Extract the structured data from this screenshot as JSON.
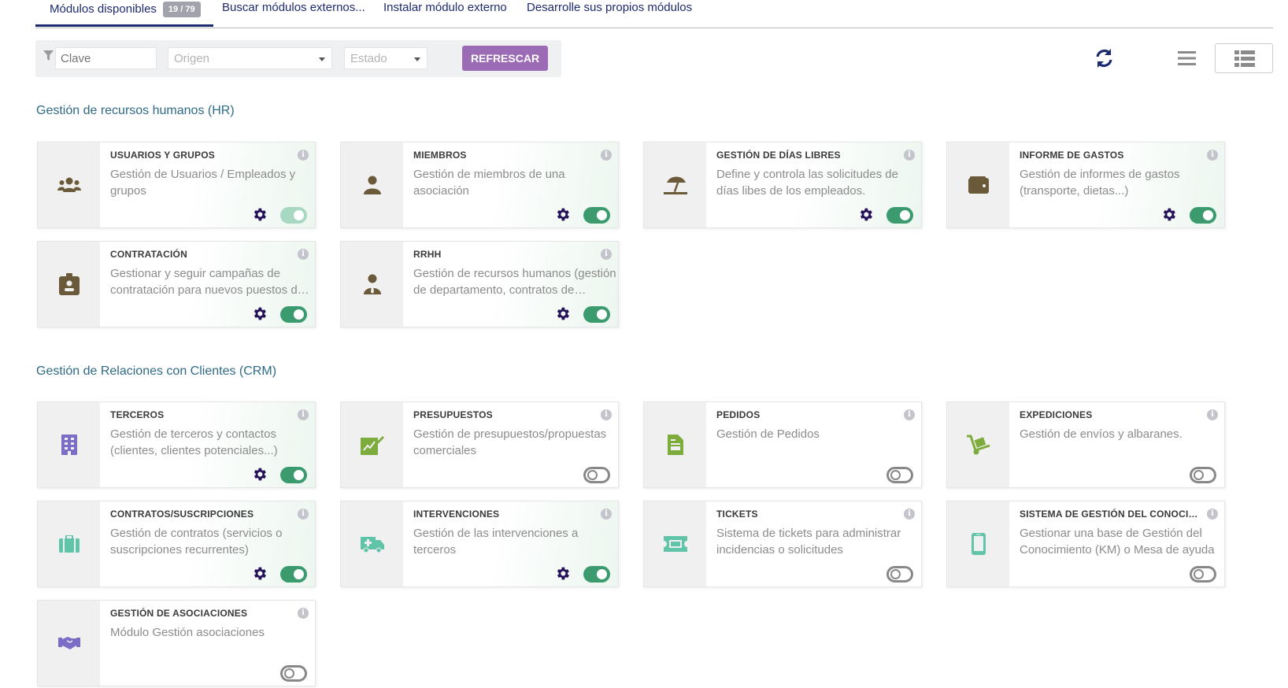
{
  "tabs": {
    "available_label": "Módulos disponibles",
    "available_count": "19 / 79",
    "search_label": "Buscar módulos externos...",
    "install_label": "Instalar módulo externo",
    "develop_label": "Desarrolle sus propios módulos"
  },
  "filter": {
    "keyword_placeholder": "Clave",
    "origin_placeholder": "Origen",
    "status_placeholder": "Estado",
    "refresh_label": "REFRESCAR"
  },
  "colors": {
    "accent": "#9b6bb5",
    "nav": "#1e2a6e",
    "toggle_on": "#3b9b6e",
    "hr_icon": "#6b5a3a",
    "crm_purple": "#7b6cc6",
    "crm_green": "#7dab3c",
    "crm_teal": "#5fc4a8"
  },
  "sections": [
    {
      "title": "Gestión de recursos humanos (HR)",
      "modules": [
        {
          "name": "USUARIOS Y GRUPOS",
          "description": "Gestión de Usuarios / Empleados y grupos",
          "icon": "users-icon",
          "enabled": true,
          "configurable": true
        },
        {
          "name": "MIEMBROS",
          "description": "Gestión de miembros de una asociación",
          "icon": "member-icon",
          "enabled": true,
          "configurable": true
        },
        {
          "name": "GESTIÓN DE DÍAS LIBRES",
          "description": "Define y controla las solicitudes de días libes de los empleados.",
          "icon": "beach-umbrella-icon",
          "enabled": true,
          "configurable": true
        },
        {
          "name": "INFORME DE GASTOS",
          "description": "Gestión de informes de gastos (transporte, dietas...)",
          "icon": "wallet-icon",
          "enabled": true,
          "configurable": true
        },
        {
          "name": "CONTRATACIÓN",
          "description": "Gestionar y seguir campañas de contratación para nuevos puestos de trabajo",
          "icon": "id-badge-icon",
          "enabled": true,
          "configurable": true
        },
        {
          "name": "RRHH",
          "description": "Gestión de recursos humanos (gestión de departamento, contratos de empleados...)",
          "icon": "user-tie-icon",
          "enabled": true,
          "configurable": true
        }
      ]
    },
    {
      "title": "Gestión de Relaciones con Clientes (CRM)",
      "modules": [
        {
          "name": "TERCEROS",
          "description": "Gestión de terceros y contactos (clientes, clientes potenciales...)",
          "icon": "building-icon",
          "enabled": true,
          "configurable": true
        },
        {
          "name": "PRESUPUESTOS",
          "description": "Gestión de presupuestos/propuestas comerciales",
          "icon": "signature-icon",
          "enabled": false,
          "configurable": false
        },
        {
          "name": "PEDIDOS",
          "description": "Gestión de Pedidos",
          "icon": "file-invoice-icon",
          "enabled": false,
          "configurable": false
        },
        {
          "name": "EXPEDICIONES",
          "description": "Gestión de envíos y albaranes.",
          "icon": "dolly-icon",
          "enabled": false,
          "configurable": false
        },
        {
          "name": "CONTRATOS/SUSCRIPCIONES",
          "description": "Gestión de contratos (servicios o suscripciones recurrentes)",
          "icon": "suitcase-icon",
          "enabled": true,
          "configurable": true
        },
        {
          "name": "INTERVENCIONES",
          "description": "Gestión de las intervenciones a terceros",
          "icon": "ambulance-icon",
          "enabled": true,
          "configurable": true
        },
        {
          "name": "TICKETS",
          "description": "Sistema de tickets para administrar incidencias o solicitudes",
          "icon": "ticket-icon",
          "enabled": false,
          "configurable": false
        },
        {
          "name": "SISTEMA DE GESTIÓN DEL CONOCIMIENTO",
          "description": "Gestionar una base de Gestión del Conocimiento (KM) o Mesa de ayuda",
          "icon": "mobile-icon",
          "enabled": false,
          "configurable": false
        },
        {
          "name": "GESTIÓN DE ASOCIACIONES",
          "description": "Módulo Gestión asociaciones",
          "icon": "handshake-icon",
          "enabled": false,
          "configurable": false
        }
      ]
    }
  ]
}
